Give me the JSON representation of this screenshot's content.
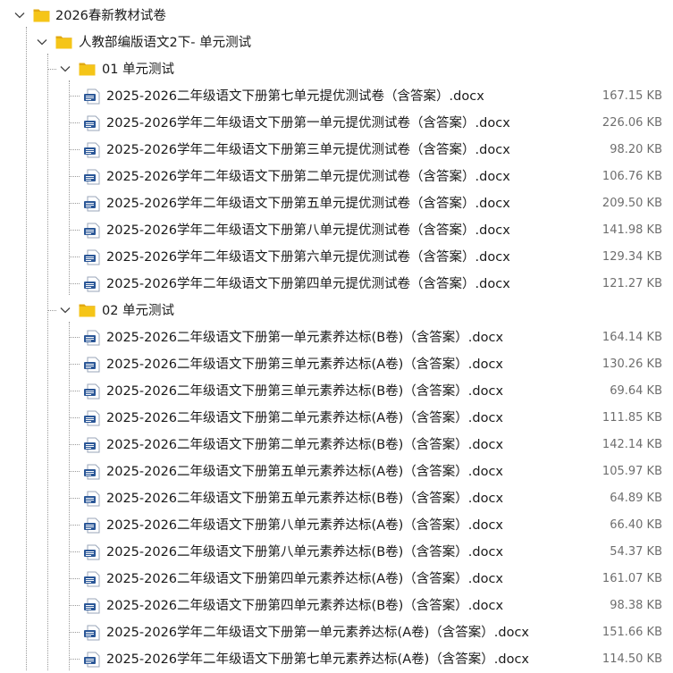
{
  "root": {
    "label": "2026春新教材试卷"
  },
  "subject": {
    "label": "人教部编版语文2下- 单元测试"
  },
  "groups": [
    {
      "label": "01 单元测试",
      "files": [
        {
          "name": "2025-2026二年级语文下册第七单元提优测试卷（含答案）.docx",
          "size": "167.15 KB"
        },
        {
          "name": "2025-2026学年二年级语文下册第一单元提优测试卷（含答案）.docx",
          "size": "226.06 KB"
        },
        {
          "name": "2025-2026学年二年级语文下册第三单元提优测试卷（含答案）.docx",
          "size": "98.20 KB"
        },
        {
          "name": "2025-2026学年二年级语文下册第二单元提优测试卷（含答案）.docx",
          "size": "106.76 KB"
        },
        {
          "name": "2025-2026学年二年级语文下册第五单元提优测试卷（含答案）.docx",
          "size": "209.50 KB"
        },
        {
          "name": "2025-2026学年二年级语文下册第八单元提优测试卷（含答案）.docx",
          "size": "141.98 KB"
        },
        {
          "name": "2025-2026学年二年级语文下册第六单元提优测试卷（含答案）.docx",
          "size": "129.34 KB"
        },
        {
          "name": "2025-2026学年二年级语文下册第四单元提优测试卷（含答案）.docx",
          "size": "121.27 KB"
        }
      ]
    },
    {
      "label": "02 单元测试",
      "files": [
        {
          "name": "2025-2026二年级语文下册第一单元素养达标(B卷)（含答案）.docx",
          "size": "164.14 KB"
        },
        {
          "name": "2025-2026二年级语文下册第三单元素养达标(A卷)（含答案）.docx",
          "size": "130.26 KB"
        },
        {
          "name": "2025-2026二年级语文下册第三单元素养达标(B卷)（含答案）.docx",
          "size": "69.64 KB"
        },
        {
          "name": "2025-2026二年级语文下册第二单元素养达标(A卷)（含答案）.docx",
          "size": "111.85 KB"
        },
        {
          "name": "2025-2026二年级语文下册第二单元素养达标(B卷)（含答案）.docx",
          "size": "142.14 KB"
        },
        {
          "name": "2025-2026二年级语文下册第五单元素养达标(A卷)（含答案）.docx",
          "size": "105.97 KB"
        },
        {
          "name": "2025-2026二年级语文下册第五单元素养达标(B卷)（含答案）.docx",
          "size": "64.89 KB"
        },
        {
          "name": "2025-2026二年级语文下册第八单元素养达标(A卷)（含答案）.docx",
          "size": "66.40 KB"
        },
        {
          "name": "2025-2026二年级语文下册第八单元素养达标(B卷)（含答案）.docx",
          "size": "54.37 KB"
        },
        {
          "name": "2025-2026二年级语文下册第四单元素养达标(A卷)（含答案）.docx",
          "size": "161.07 KB"
        },
        {
          "name": "2025-2026二年级语文下册第四单元素养达标(B卷)（含答案）.docx",
          "size": "98.38 KB"
        },
        {
          "name": "2025-2026学年二年级语文下册第一单元素养达标(A卷)（含答案）.docx",
          "size": "151.66 KB"
        },
        {
          "name": "2025-2026学年二年级语文下册第七单元素养达标(A卷)（含答案）.docx",
          "size": "114.50 KB"
        }
      ]
    }
  ],
  "colors": {
    "folder": "#F5C518",
    "folder_tab": "#E2A912",
    "doc_blue": "#2B5797"
  }
}
